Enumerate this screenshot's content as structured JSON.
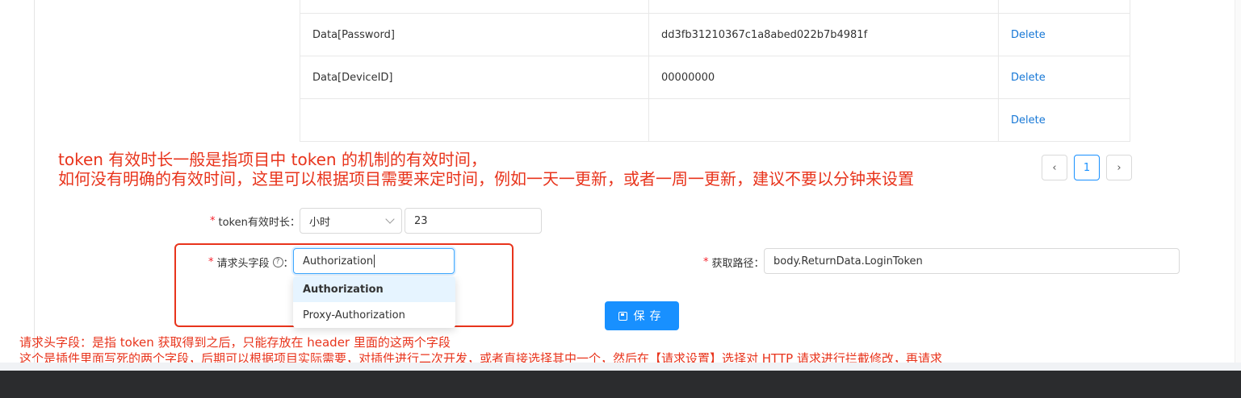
{
  "params_table": {
    "rows": [
      {
        "key": "",
        "value": "",
        "action": ""
      },
      {
        "key": "Data[Password]",
        "value": "dd3fb31210367c1a8abed022b7b4981f",
        "action": "Delete"
      },
      {
        "key": "Data[DeviceID]",
        "value": "00000000",
        "action": "Delete"
      },
      {
        "key": "",
        "value": "",
        "action": "Delete"
      }
    ]
  },
  "pagination": {
    "prev": "‹",
    "current": "1",
    "next": "›"
  },
  "annotations": {
    "top_line1": "token 有效时长一般是指项目中 token 的机制的有效时间，",
    "top_line2": "如何没有明确的有效时间，这里可以根据项目需要来定时间，例如一天一更新，或者一周一更新，建议不要以分钟来设置",
    "bottom_line1": "请求头字段：是指 token 获取得到之后，只能存放在 header 里面的这两个字段",
    "bottom_line2": "这个是插件里面写死的两个字段，后期可以根据项目实际需要，对插件进行二次开发，或者直接选择其中一个，然后在【请求设置】选择对 HTTP 请求进行拦截修改，再请求"
  },
  "form": {
    "required_mark": "*",
    "token_duration": {
      "label": "token有效时长：",
      "unit_value": "小时",
      "amount_value": "23"
    },
    "header_field": {
      "label": "请求头字段",
      "help_icon": "?",
      "colon": "：",
      "value": "Authorization",
      "options": [
        "Authorization",
        "Proxy-Authorization"
      ]
    },
    "fetch_path": {
      "label": "获取路径：",
      "value": "body.ReturnData.LoginToken"
    }
  },
  "save_button": {
    "label": "保存",
    "icon": "save-icon"
  },
  "colors": {
    "primary": "#1890ff",
    "annotation": "#e8341c",
    "required": "#f5222d"
  }
}
